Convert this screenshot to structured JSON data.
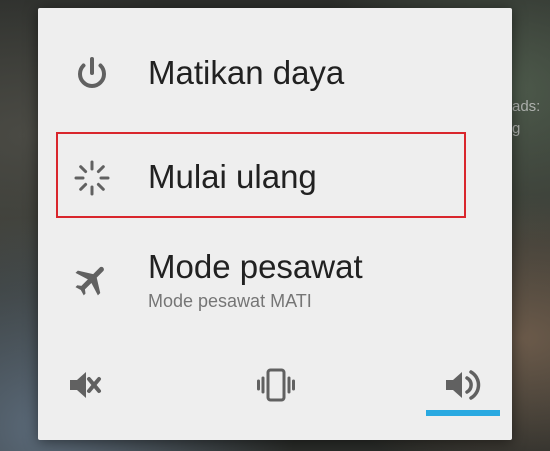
{
  "background": {
    "partial_text_1": "ads:",
    "partial_text_2": "g"
  },
  "power_menu": {
    "items": [
      {
        "icon": "power-icon",
        "label": "Matikan daya"
      },
      {
        "icon": "restart-icon",
        "label": "Mulai ulang"
      },
      {
        "icon": "airplane-icon",
        "label": "Mode pesawat",
        "subtitle": "Mode pesawat MATI"
      }
    ],
    "highlighted_item": "Mulai ulang",
    "sound_modes": [
      {
        "icon": "volume-mute-icon",
        "selected": false
      },
      {
        "icon": "vibrate-icon",
        "selected": false
      },
      {
        "icon": "volume-on-icon",
        "selected": true
      }
    ]
  },
  "colors": {
    "dialog_bg": "#eeeeee",
    "highlight_border": "#d9262c",
    "selected_indicator": "#29a9e1",
    "icon": "#616161",
    "text_primary": "#212121",
    "text_secondary": "#757575"
  }
}
